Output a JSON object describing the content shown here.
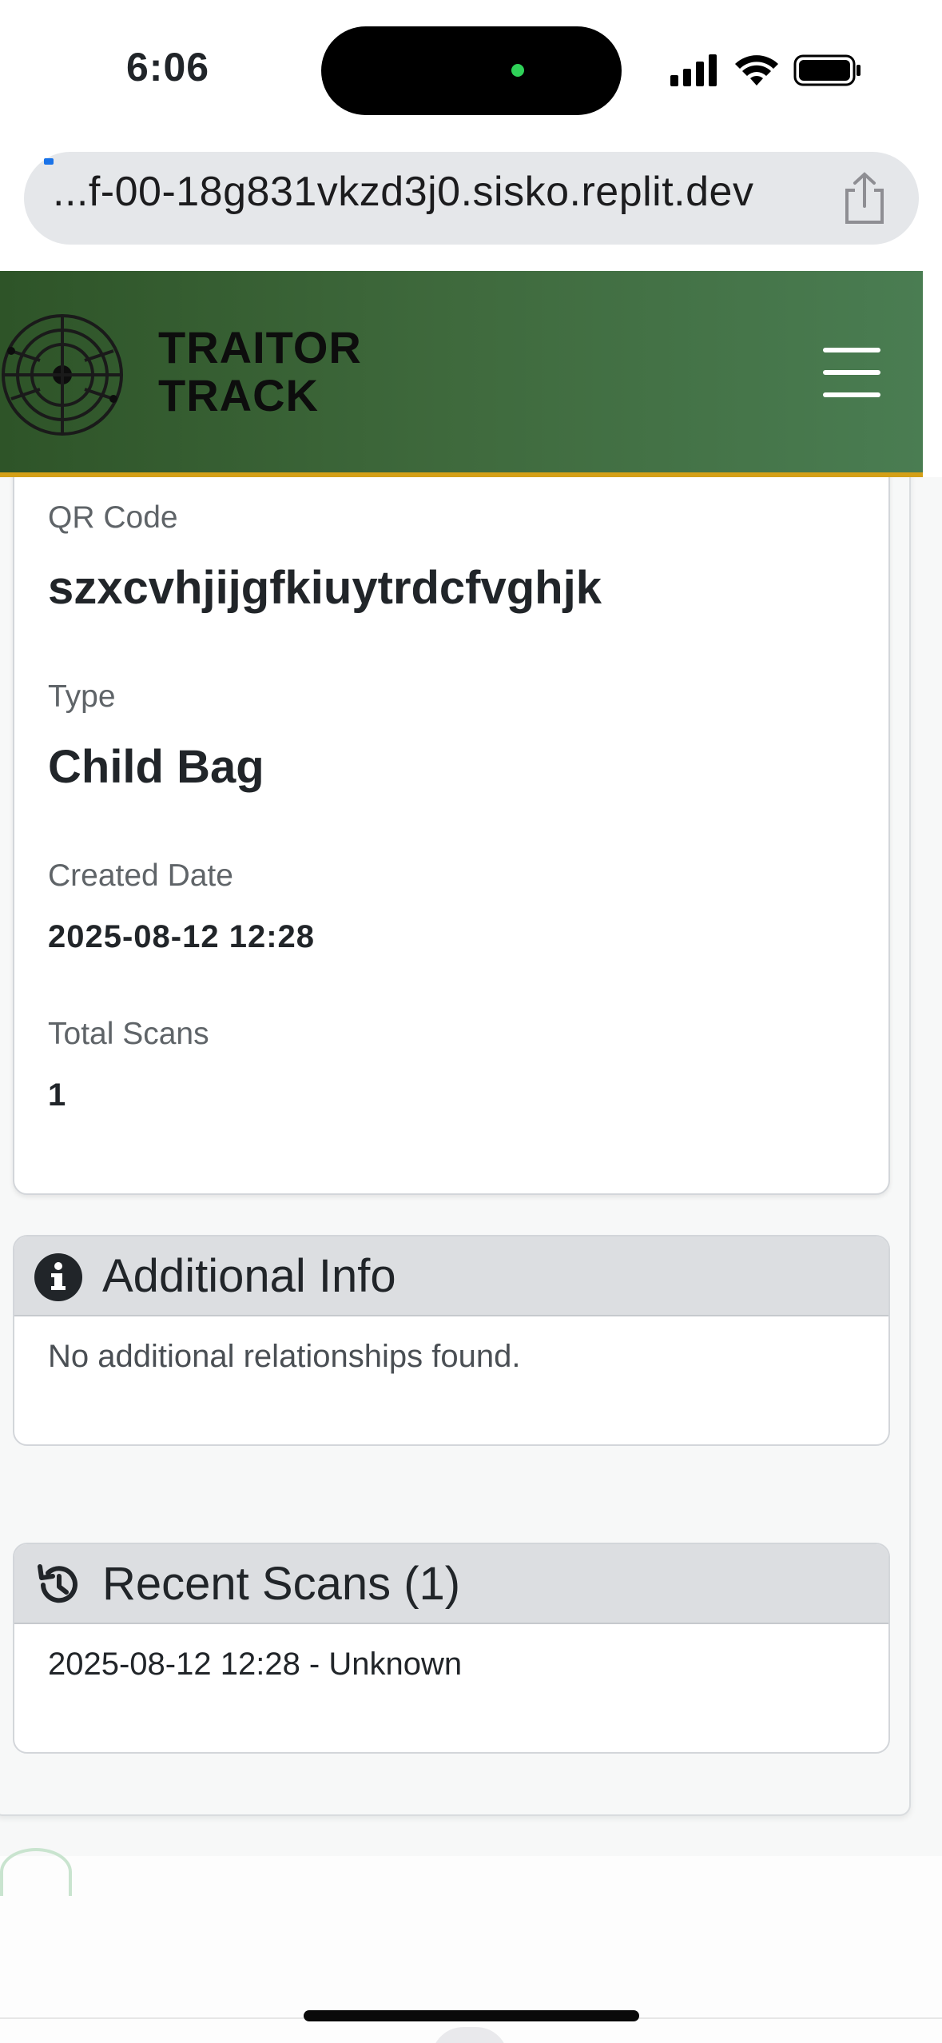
{
  "status_bar": {
    "time": "6:06"
  },
  "browser": {
    "url": "...f-00-18g831vkzd3j0.sisko.replit.dev"
  },
  "header": {
    "brand_line1": "TRAITOR",
    "brand_line2": "TRACK"
  },
  "details": {
    "qr_label": "QR Code",
    "qr_value": "szxcvhjijgfkiuytrdcfvghjk",
    "type_label": "Type",
    "type_value": "Child Bag",
    "created_label": "Created Date",
    "created_value": "2025-08-12 12:28",
    "scans_label": "Total Scans",
    "scans_value": "1"
  },
  "additional_info": {
    "title": "Additional Info",
    "icon": "info-circle-icon",
    "body": "No additional relationships found."
  },
  "recent_scans": {
    "title": "Recent Scans (1)",
    "icon": "history-icon",
    "items": [
      "2025-08-12 12:28 - Unknown"
    ]
  },
  "colors": {
    "header_start": "#2e5428",
    "header_end": "#4a7d52",
    "header_border": "#d4a017",
    "card_header_bg": "#dcdee1"
  }
}
